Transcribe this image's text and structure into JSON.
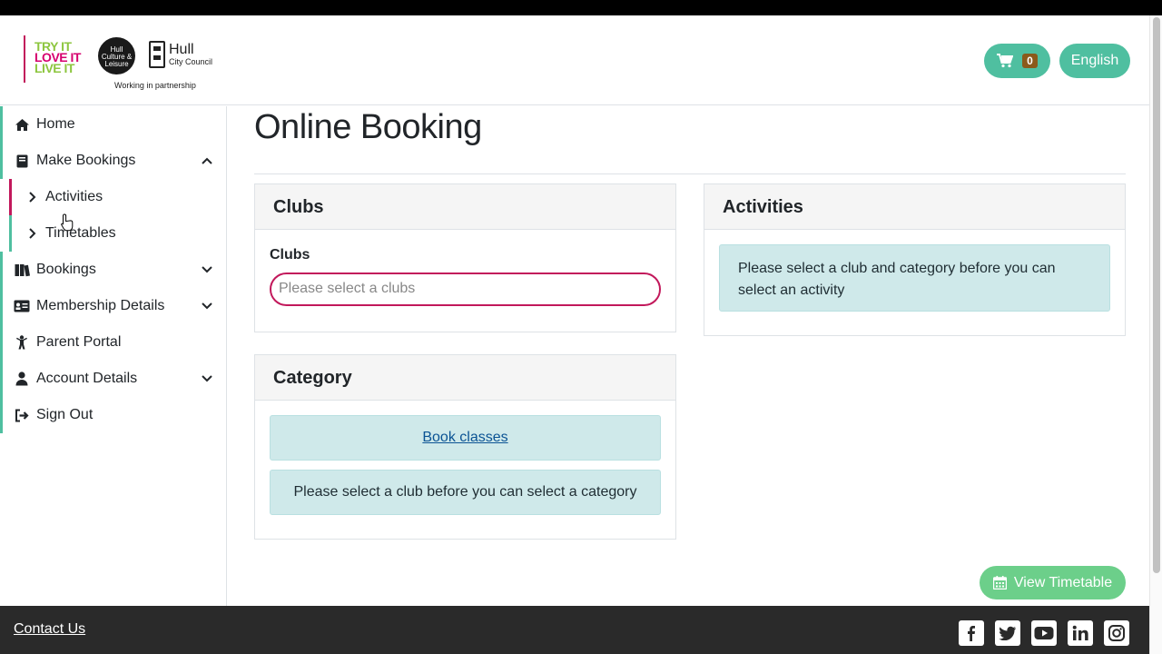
{
  "header": {
    "logo": {
      "line1": "TRY IT",
      "line2": "LOVE IT",
      "line3": "LIVE IT",
      "hcl": "Hull Culture & Leisure",
      "hcc_name": "Hull",
      "hcc_sub": "City Council",
      "tagline": "Working in partnership"
    },
    "cart_count": "0",
    "language": "English"
  },
  "sidebar": {
    "items": [
      {
        "label": "Home",
        "icon": "home-icon"
      },
      {
        "label": "Make Bookings",
        "icon": "book-icon",
        "expanded": true
      },
      {
        "label": "Bookings",
        "icon": "books-icon"
      },
      {
        "label": "Membership Details",
        "icon": "id-card-icon"
      },
      {
        "label": "Parent Portal",
        "icon": "child-icon"
      },
      {
        "label": "Account Details",
        "icon": "user-icon"
      },
      {
        "label": "Sign Out",
        "icon": "sign-out-icon"
      }
    ],
    "subitems": [
      {
        "label": "Activities",
        "active": true
      },
      {
        "label": "Timetables",
        "active": false
      }
    ]
  },
  "main": {
    "title": "Online Booking",
    "clubs": {
      "header": "Clubs",
      "label": "Clubs",
      "placeholder": "Please select a clubs"
    },
    "category": {
      "header": "Category",
      "book_link": "Book classes",
      "message": "Please select a club before you can select a category"
    },
    "activities": {
      "header": "Activities",
      "message": "Please select a club and category before you can select an activity"
    },
    "view_timetable": "View Timetable"
  },
  "footer": {
    "contact": "Contact Us",
    "social": [
      "facebook-icon",
      "twitter-icon",
      "youtube-icon",
      "linkedin-icon",
      "instagram-icon"
    ]
  },
  "colors": {
    "teal": "#4fbfa0",
    "magenta": "#c2185b",
    "green_button": "#6ccf8a",
    "info_bg": "#cfe9ea",
    "footer_bg": "#2a2a2a"
  }
}
